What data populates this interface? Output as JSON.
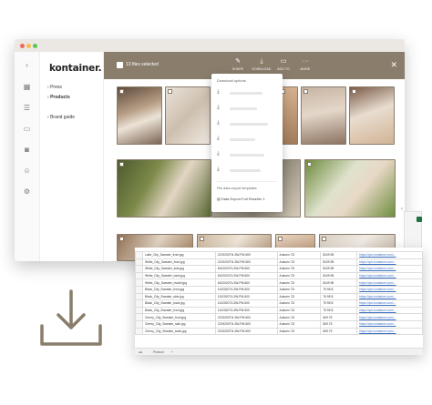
{
  "app": {
    "logo": "kontainer.",
    "nav": [
      {
        "label": "Press",
        "bold": false
      },
      {
        "label": "Products",
        "bold": true
      },
      {
        "label": "Brand guide",
        "bold": false
      }
    ]
  },
  "toolbar": {
    "selected_count": "13 files selected",
    "buttons": [
      {
        "label": "SHARE",
        "icon": "share-icon"
      },
      {
        "label": "DOWNLOAD",
        "icon": "download-icon"
      },
      {
        "label": "ADD TO",
        "icon": "folder-add-icon"
      },
      {
        "label": "MORE",
        "icon": "more-icon"
      }
    ]
  },
  "download_menu": {
    "header": "Download options",
    "export_header": "File data export templates",
    "template_label": "Data Export Full Reseller 1"
  },
  "spreadsheet": {
    "rows": [
      [
        "Latte_City_Sweater_front.jpg",
        "2219200TI4-3W-PM-500",
        "Autumn '23",
        "$109.95",
        "https://ipm.kontainer.com/..."
      ],
      [
        "White_City_Sweater_front.jpg",
        "2219200TI4-3W-PM-500",
        "Autumn '23",
        "$109.95",
        "https://ipm.kontainer.com/..."
      ],
      [
        "White_City_Sweater_side.jpg",
        "6102020T4-3W-PM-500",
        "Autumn '23",
        "$109.95",
        "https://ipm.kontainer.com/..."
      ],
      [
        "White_City_Sweater_back.jpg",
        "6102020T4-3W-PM-500",
        "Autumn '23",
        "$109.95",
        "https://ipm.kontainer.com/..."
      ],
      [
        "White_City_Sweater_model.jpg",
        "6102020T4-3W-PM-500",
        "Autumn '23",
        "$109.95",
        "https://ipm.kontainer.com/..."
      ],
      [
        "Black_City_Sweater_front.jpg",
        "1102020T4-3W-PM-500",
        "Autumn '23",
        "79.95 $",
        "https://ipm.kontainer.com/..."
      ],
      [
        "Black_City_Sweater_side.jpg",
        "1102020T4-3W-PM-500",
        "Autumn '23",
        "79.95 $",
        "https://ipm.kontainer.com/..."
      ],
      [
        "Black_City_Sweater_back.jpg",
        "1102020T4-3W-PM-500",
        "Autumn '23",
        "79.95 $",
        "https://ipm.kontainer.com/..."
      ],
      [
        "Black_City_Sweater_front.jpg",
        "1102020T4-3W-PM-500",
        "Autumn '23",
        "79.95 $",
        "https://ipm.kontainer.com/..."
      ],
      [
        "Cherry_City_Sweater_front.jpg",
        "2219200TI4-3W-PM-500",
        "Autumn '23",
        "$49.75",
        "https://ipm.kontainer.com/..."
      ],
      [
        "Cherry_City_Sweater_side.jpg",
        "2219200TI4-3W-PM-500",
        "Autumn '23",
        "$49.75",
        "https://ipm.kontainer.com/..."
      ],
      [
        "Cherry_City_Sweater_back.jpg",
        "2219200TI4-3W-PM-500",
        "Autumn '23",
        "$49.75",
        "https://ipm.kontainer.com/..."
      ]
    ],
    "sheet_tab": "Product"
  },
  "colors": {
    "accent": "#8a7d6c",
    "excel_green": "#1f7244"
  }
}
